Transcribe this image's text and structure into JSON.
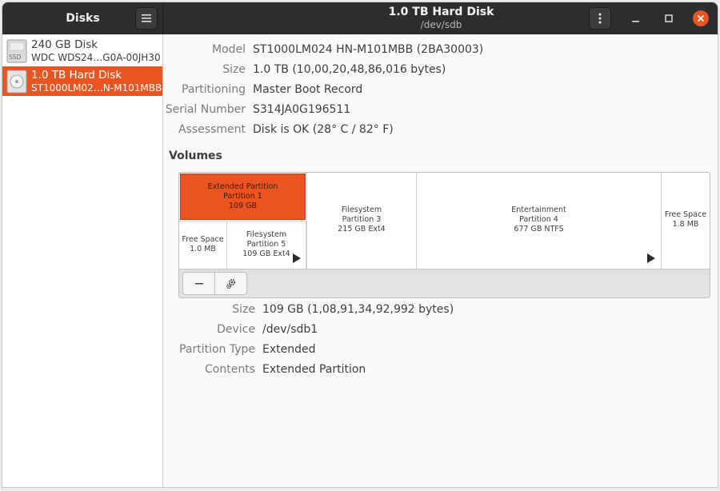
{
  "sidebar": {
    "title": "Disks",
    "disks": [
      {
        "name": "240 GB Disk",
        "sub": "WDC WDS24…G0A-00JH30",
        "icon": "ssd-icon",
        "icon_text": "SSD",
        "selected": false
      },
      {
        "name": "1.0 TB Hard Disk",
        "sub": "ST1000LM02…N-M101MBB",
        "icon": "hard-disk-icon",
        "selected": true
      }
    ]
  },
  "header": {
    "title": "1.0 TB Hard Disk",
    "subtitle": "/dev/sdb"
  },
  "disk_info": [
    {
      "label": "Model",
      "value": "ST1000LM024 HN-M101MBB (2BA30003)"
    },
    {
      "label": "Size",
      "value": "1.0 TB (10,00,20,48,86,016 bytes)"
    },
    {
      "label": "Partitioning",
      "value": "Master Boot Record"
    },
    {
      "label": "Serial Number",
      "value": "S314JA0G196511"
    },
    {
      "label": "Assessment",
      "value": "Disk is OK (28° C / 82° F)"
    }
  ],
  "volumes": {
    "title": "Volumes",
    "extended": {
      "line1": "Extended Partition",
      "line2": "Partition 1",
      "line3": "109 GB"
    },
    "free1": {
      "line1": "Free Space",
      "line2": "1.0 MB"
    },
    "part5": {
      "line1": "Filesystem",
      "line2": "Partition 5",
      "line3": "109 GB Ext4"
    },
    "part3": {
      "line1": "Filesystem",
      "line2": "Partition 3",
      "line3": "215 GB Ext4"
    },
    "part4": {
      "line1": "Entertainment",
      "line2": "Partition 4",
      "line3": "677 GB NTFS"
    },
    "free2": {
      "line1": "Free Space",
      "line2": "1.8 MB"
    }
  },
  "selected_volume": [
    {
      "label": "Size",
      "value": "109 GB (1,08,91,34,92,992 bytes)"
    },
    {
      "label": "Device",
      "value": "/dev/sdb1"
    },
    {
      "label": "Partition Type",
      "value": "Extended"
    },
    {
      "label": "Contents",
      "value": "Extended Partition"
    }
  ],
  "colors": {
    "accent": "#e95420",
    "headerbar": "#2d2d2d"
  }
}
